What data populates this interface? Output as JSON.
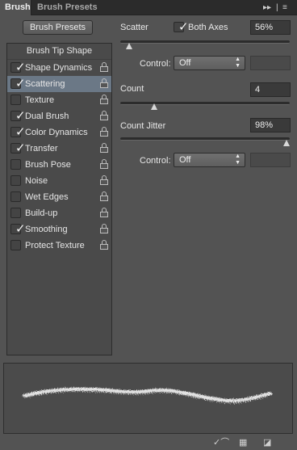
{
  "tabs": [
    {
      "label": "Brush",
      "active": true
    },
    {
      "label": "Brush Presets",
      "active": false
    }
  ],
  "panel_icons": [
    "forward-arrows-icon",
    "panel-menu-icon"
  ],
  "brush_presets_button": "Brush Presets",
  "brush_tip_shape": "Brush Tip Shape",
  "options": [
    {
      "label": "Shape Dynamics",
      "checked": true,
      "selected": false,
      "locked": true
    },
    {
      "label": "Scattering",
      "checked": true,
      "selected": true,
      "locked": true
    },
    {
      "label": "Texture",
      "checked": false,
      "selected": false,
      "locked": true
    },
    {
      "label": "Dual Brush",
      "checked": true,
      "selected": false,
      "locked": true
    },
    {
      "label": "Color Dynamics",
      "checked": true,
      "selected": false,
      "locked": true
    },
    {
      "label": "Transfer",
      "checked": true,
      "selected": false,
      "locked": true
    },
    {
      "label": "Brush Pose",
      "checked": false,
      "selected": false,
      "locked": true
    },
    {
      "label": "Noise",
      "checked": false,
      "selected": false,
      "locked": true
    },
    {
      "label": "Wet Edges",
      "checked": false,
      "selected": false,
      "locked": true
    },
    {
      "label": "Build-up",
      "checked": false,
      "selected": false,
      "locked": true
    },
    {
      "label": "Smoothing",
      "checked": true,
      "selected": false,
      "locked": true
    },
    {
      "label": "Protect Texture",
      "checked": false,
      "selected": false,
      "locked": true
    }
  ],
  "scatter": {
    "label": "Scatter",
    "both_axes_label": "Both Axes",
    "both_axes_checked": true,
    "value": "56%",
    "slider_fraction": 0.05,
    "control_label": "Control:",
    "control_value": "Off"
  },
  "count": {
    "label": "Count",
    "value": "4",
    "slider_fraction": 0.2
  },
  "count_jitter": {
    "label": "Count Jitter",
    "value": "98%",
    "slider_fraction": 0.98,
    "control_label": "Control:",
    "control_value": "Off"
  },
  "bottom_icons": [
    "eye-brush-icon",
    "grid-icon",
    "new-preset-icon"
  ],
  "colors": {
    "panel_bg": "#535353",
    "selected_row": "#6b7886",
    "stroke": "#f2f2f2"
  }
}
